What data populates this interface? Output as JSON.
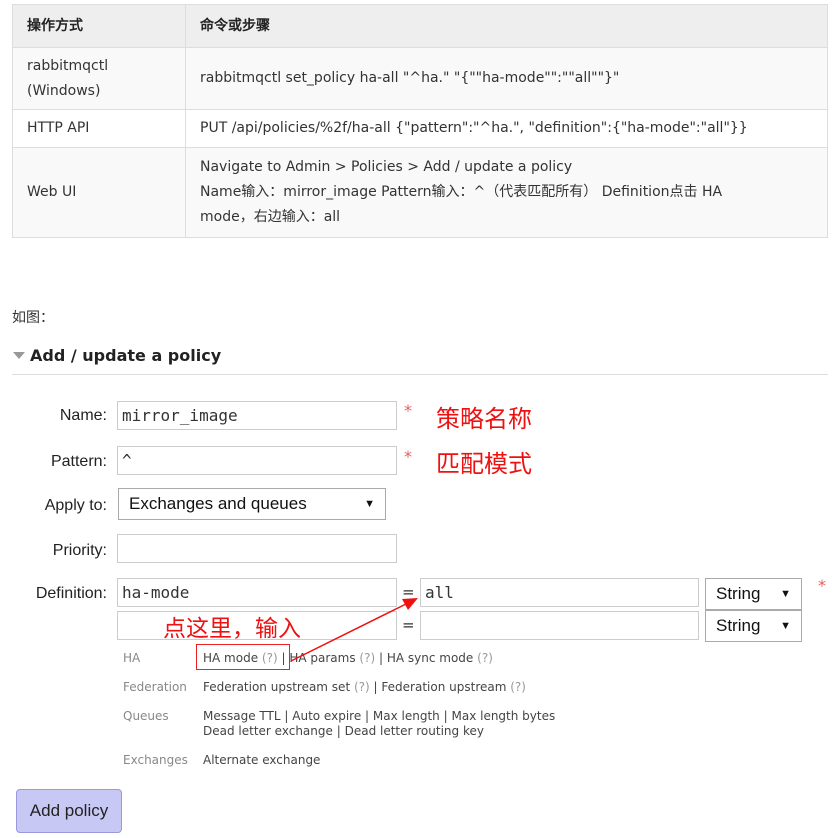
{
  "table": {
    "headers": [
      "操作方式",
      "命令或步骤"
    ],
    "rows": [
      {
        "method_line1": "rabbitmqctl",
        "method_line2": "(Windows)",
        "step": "rabbitmqctl set_policy ha-all \"^ha.\" \"{\"\"ha-mode\"\":\"\"all\"\"}\""
      },
      {
        "method": "HTTP API",
        "step": "PUT /api/policies/%2f/ha-all {\"pattern\":\"^ha.\", \"definition\":{\"ha-mode\":\"all\"}}"
      },
      {
        "method": "Web UI",
        "step_line1": "Navigate to Admin > Policies > Add / update a policy",
        "step_line2": "Name输入：mirror_image Pattern输入：^（代表匹配所有） Definition点击 HA",
        "step_line3": "mode，右边输入：all"
      }
    ]
  },
  "intro": "如图：",
  "policy_form": {
    "title": "Add / update a policy",
    "name_label": "Name:",
    "name_value": "mirror_image",
    "name_note": "策略名称",
    "pattern_label": "Pattern:",
    "pattern_value": "^",
    "pattern_note": "匹配模式",
    "apply_label": "Apply to:",
    "apply_value": "Exchanges and queues",
    "priority_label": "Priority:",
    "priority_value": "",
    "definition_label": "Definition:",
    "def_rows": [
      {
        "key": "ha-mode",
        "value": "all",
        "type": "String"
      },
      {
        "key": "",
        "value": "",
        "type": "String"
      }
    ],
    "eq": "=",
    "star": "*",
    "click_note": "点这里，输入",
    "hints": {
      "ha": {
        "category": "HA",
        "ha_mode": "HA mode",
        "ha_params": "HA params",
        "ha_sync": "HA sync mode"
      },
      "federation": {
        "category": "Federation",
        "upstream_set": "Federation upstream set",
        "upstream": "Federation upstream"
      },
      "queues": {
        "category": "Queues",
        "ttl": "Message TTL",
        "expire": "Auto expire",
        "max_len": "Max length",
        "max_len_bytes": "Max length bytes",
        "dlx": "Dead letter exchange",
        "dlrk": "Dead letter routing key"
      },
      "exchanges": {
        "category": "Exchanges",
        "alt": "Alternate exchange"
      },
      "q": "(?)",
      "sep": "|"
    },
    "add_button": "Add policy"
  },
  "colors": {
    "annotation_red": "#ee1111",
    "button_bg": "#c8c8f4",
    "header_bg": "#eeeeee"
  },
  "icons": {
    "collapse": "triangle-down-icon",
    "arrow": "arrow-icon"
  }
}
